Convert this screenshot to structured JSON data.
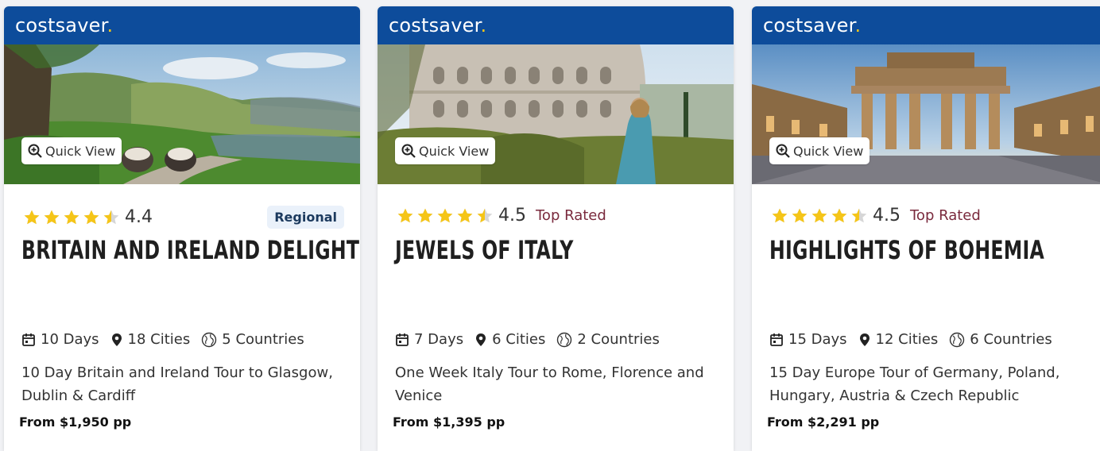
{
  "brand": {
    "name": "costsaver",
    "dot": "."
  },
  "quick_view_label": "Quick View",
  "colors": {
    "brand_bar": "#0d4c9b",
    "star": "#f5c518",
    "top_rated": "#7a2a3d"
  },
  "cards": [
    {
      "rating": "4.4",
      "rating_value": 4.4,
      "badge": "Regional",
      "top_rated": "",
      "title": "BRITAIN AND IRELAND DELIGHT",
      "days": "10 Days",
      "cities": "18 Cities",
      "countries": "5 Countries",
      "description": "10 Day Britain and Ireland Tour to Glasgow, Dublin & Cardiff",
      "price": "From $1,950 pp"
    },
    {
      "rating": "4.5",
      "rating_value": 4.5,
      "badge": "",
      "top_rated": "Top Rated",
      "title": "JEWELS OF ITALY",
      "days": "7 Days",
      "cities": "6 Cities",
      "countries": "2 Countries",
      "description": "One Week Italy Tour to Rome, Florence and Venice",
      "price": "From $1,395 pp"
    },
    {
      "rating": "4.5",
      "rating_value": 4.5,
      "badge": "",
      "top_rated": "Top Rated",
      "title": "HIGHLIGHTS OF BOHEMIA",
      "days": "15 Days",
      "cities": "12 Cities",
      "countries": "6 Countries",
      "description": "15 Day Europe Tour of Germany, Poland, Hungary, Austria & Czech Republic",
      "price": "From $2,291 pp"
    }
  ]
}
